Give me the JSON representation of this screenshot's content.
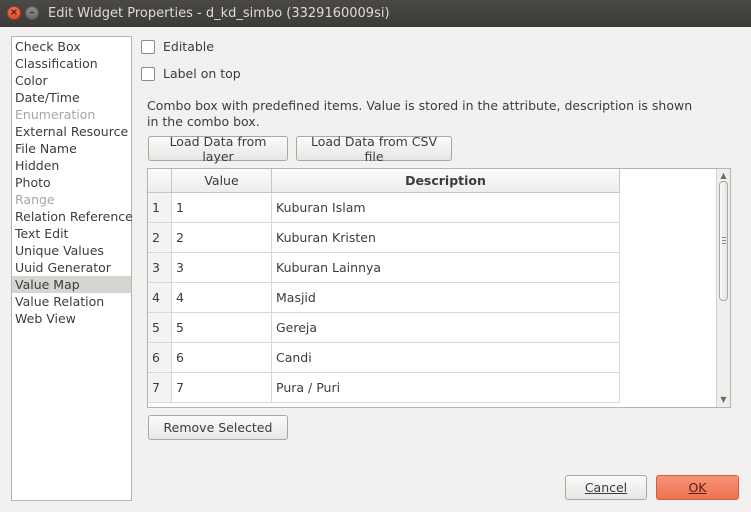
{
  "window": {
    "title": "Edit Widget Properties - d_kd_simbo (3329160009si)",
    "close_glyph": "×",
    "min_glyph": "–"
  },
  "types": [
    {
      "label": "Check Box",
      "state": "normal"
    },
    {
      "label": "Classification",
      "state": "normal"
    },
    {
      "label": "Color",
      "state": "normal"
    },
    {
      "label": "Date/Time",
      "state": "normal"
    },
    {
      "label": "Enumeration",
      "state": "disabled"
    },
    {
      "label": "External Resource",
      "state": "normal"
    },
    {
      "label": "File Name",
      "state": "normal"
    },
    {
      "label": "Hidden",
      "state": "normal"
    },
    {
      "label": "Photo",
      "state": "normal"
    },
    {
      "label": "Range",
      "state": "disabled"
    },
    {
      "label": "Relation Reference",
      "state": "normal"
    },
    {
      "label": "Text Edit",
      "state": "normal"
    },
    {
      "label": "Unique Values",
      "state": "normal"
    },
    {
      "label": "Uuid Generator",
      "state": "normal"
    },
    {
      "label": "Value Map",
      "state": "selected"
    },
    {
      "label": "Value Relation",
      "state": "normal"
    },
    {
      "label": "Web View",
      "state": "normal"
    }
  ],
  "options": {
    "editable_label": "Editable",
    "label_on_top_label": "Label on top"
  },
  "description": "Combo box with predefined items. Value is stored in the attribute, description is shown in the combo box.",
  "buttons": {
    "load_layer": "Load Data from layer",
    "load_csv": "Load Data from CSV file",
    "remove_selected": "Remove Selected",
    "cancel": "Cancel",
    "ok": "OK"
  },
  "table": {
    "headers": {
      "value": "Value",
      "description": "Description"
    },
    "rows": [
      {
        "num": "1",
        "value": "1",
        "description": "Kuburan Islam"
      },
      {
        "num": "2",
        "value": "2",
        "description": "Kuburan Kristen"
      },
      {
        "num": "3",
        "value": "3",
        "description": "Kuburan Lainnya"
      },
      {
        "num": "4",
        "value": "4",
        "description": "Masjid"
      },
      {
        "num": "5",
        "value": "5",
        "description": "Gereja"
      },
      {
        "num": "6",
        "value": "6",
        "description": "Candi"
      },
      {
        "num": "7",
        "value": "7",
        "description": "Pura / Puri"
      }
    ]
  },
  "colors": {
    "titlebar": "#3c3b37",
    "ok_accent": "#ef7252",
    "selected_row": "#d6d5d2"
  }
}
